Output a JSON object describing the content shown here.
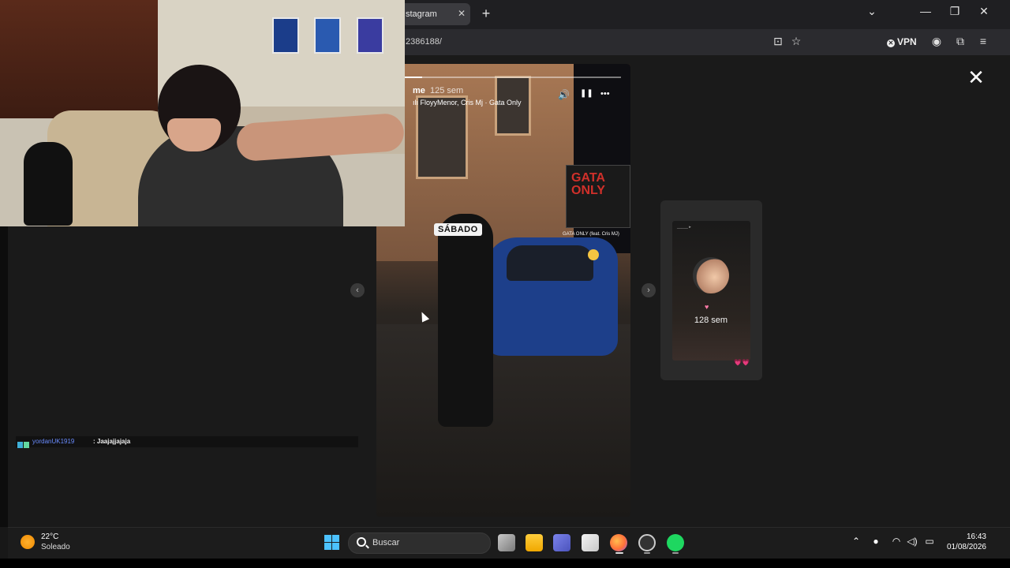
{
  "browser": {
    "tab_title": "stagram",
    "tab_close": "✕",
    "new_tab": "+",
    "url": "2386188/",
    "vpn_label": "VPN",
    "window_controls": {
      "minimize": "—",
      "restore": "❐",
      "close": "✕",
      "tab_list": "⌄"
    }
  },
  "story": {
    "user": "me",
    "time_ago": "125 sem",
    "music": "FloyyMenor, Cris Mj · Gata Only",
    "sticker_text": "SÁBADO",
    "album_text": "GATA ONLY",
    "album_caption": "GATA ONLY (feat. Cris MJ)",
    "controls": {
      "mute": "🔊",
      "pause": "❚❚",
      "more": "•••"
    },
    "progress_fraction": 0.08
  },
  "viewer": {
    "close": "✕",
    "prev": "‹",
    "next": "›"
  },
  "preview": {
    "time_ago": "128 sem",
    "heart": "♥",
    "hearts": "💗💗",
    "username_small": "_____ ▸"
  },
  "chat": {
    "username": "yordanUK1919",
    "separator": ":",
    "message": "Jaajajjajaja"
  },
  "taskbar": {
    "weather_temp": "22°C",
    "weather_desc": "Soleado",
    "search_placeholder": "Buscar",
    "time": "16:43",
    "date": "01/08/2026",
    "tray": {
      "chevron": "⌃",
      "mic": "🎙",
      "wifi": "◠",
      "volume": "🔈",
      "battery": "▭"
    }
  },
  "colors": {
    "accent_blue": "#4cc2ff",
    "spotify_green": "#1ed760",
    "firefox_orange": "#ff7139",
    "chat_user": "#6a8cff"
  }
}
